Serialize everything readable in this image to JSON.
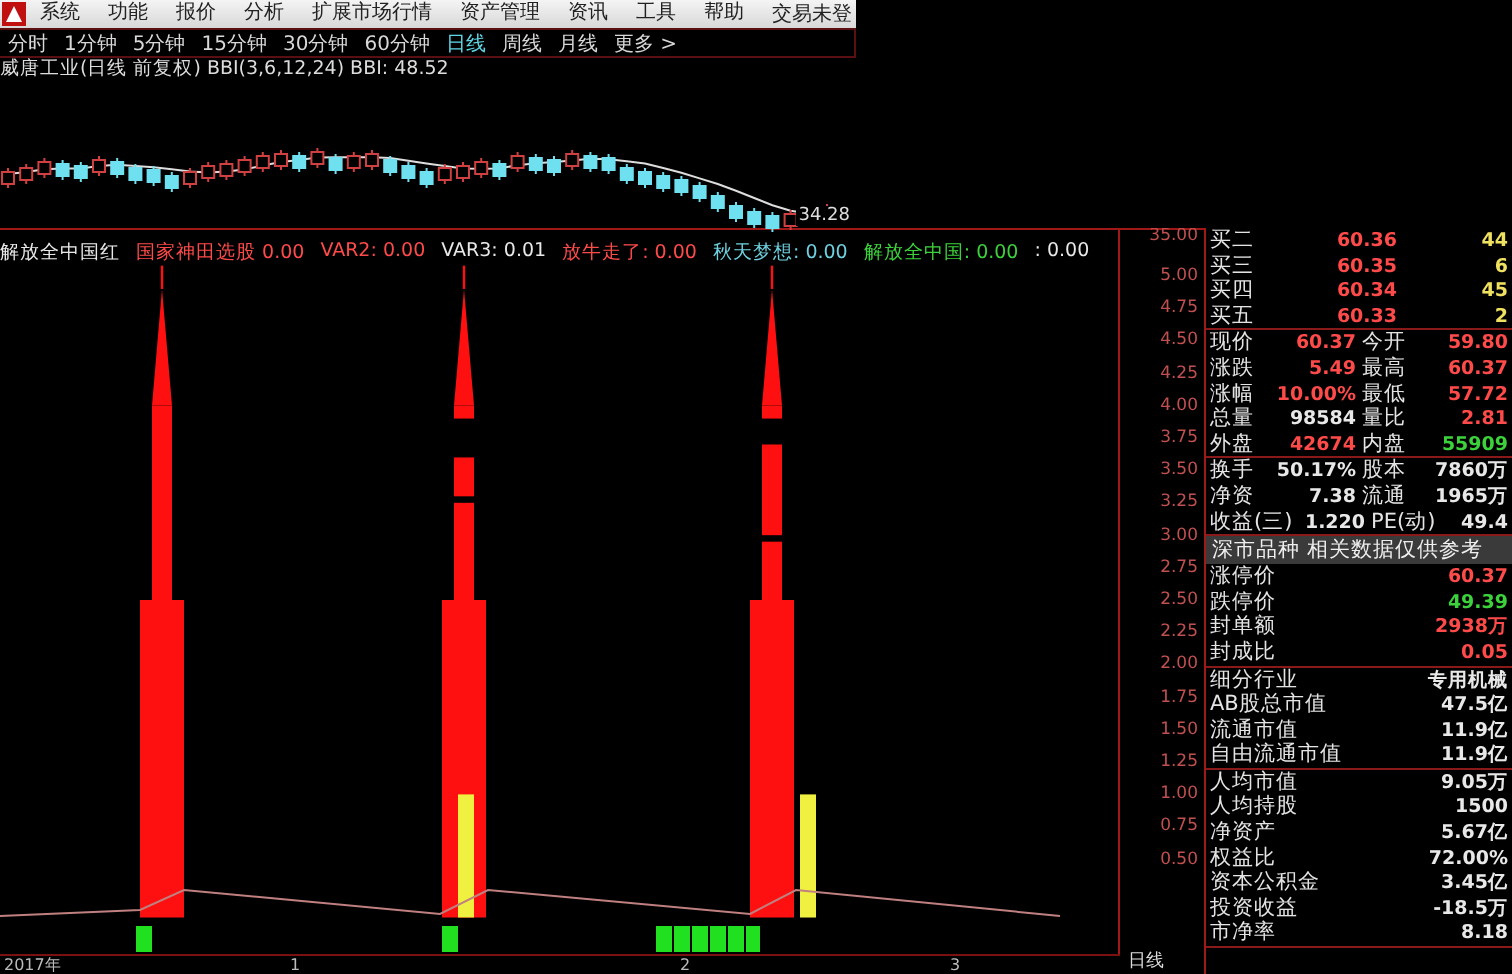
{
  "menu": [
    "系统",
    "功能",
    "报价",
    "分析",
    "扩展市场行情",
    "资产管理",
    "资讯",
    "工具",
    "帮助"
  ],
  "trade_status": "交易未登",
  "periods": [
    {
      "label": "分时",
      "selected": false
    },
    {
      "label": "1分钟",
      "selected": false
    },
    {
      "label": "5分钟",
      "selected": false
    },
    {
      "label": "15分钟",
      "selected": false
    },
    {
      "label": "30分钟",
      "selected": false
    },
    {
      "label": "60分钟",
      "selected": false
    },
    {
      "label": "日线",
      "selected": true
    },
    {
      "label": "周线",
      "selected": false
    },
    {
      "label": "月线",
      "selected": false
    },
    {
      "label": "更多 >",
      "selected": false
    }
  ],
  "price_chart": {
    "title": "威唐工业(日线 前复权) BBI(3,6,12,24) BBI: 48.52",
    "low_label": "34.28"
  },
  "indicator": {
    "name": "解放全中国红",
    "legend": [
      {
        "label": "国家神田选股",
        "value": "0.00",
        "color": "#ff4a4a"
      },
      {
        "label": "VAR2:",
        "value": "0.00",
        "color": "#ff4a4a"
      },
      {
        "label": "VAR3:",
        "value": "0.01",
        "color": "#e8e8e8"
      },
      {
        "label": "放牛走了:",
        "value": "0.00",
        "color": "#ff4a4a"
      },
      {
        "label": "秋天梦想:",
        "value": "0.00",
        "color": "#6fd0e0"
      },
      {
        "label": "解放全中国:",
        "value": "0.00",
        "color": "#3cd23c"
      },
      {
        "label": ":",
        "value": "0.00",
        "color": "#e8e8e8"
      }
    ],
    "y_labels": [
      "35.00",
      "5.00",
      "4.75",
      "4.50",
      "4.25",
      "4.00",
      "3.75",
      "3.50",
      "3.25",
      "3.00",
      "2.75",
      "2.50",
      "2.25",
      "2.00",
      "1.75",
      "1.50",
      "1.25",
      "1.00",
      "0.75",
      "0.50"
    ],
    "x_labels": [
      "2017年",
      "1",
      "2",
      "3"
    ],
    "period_label": "日线"
  },
  "quote": {
    "bids": [
      {
        "label": "买二",
        "price": "60.36",
        "volume": "44"
      },
      {
        "label": "买三",
        "price": "60.35",
        "volume": "6"
      },
      {
        "label": "买四",
        "price": "60.34",
        "volume": "45"
      },
      {
        "label": "买五",
        "price": "60.33",
        "volume": "2"
      }
    ],
    "sections": [
      {
        "kind": "pairs",
        "rows": [
          {
            "items": [
              {
                "label": "现价",
                "value": "60.37",
                "color": "#ff4a4a"
              },
              {
                "label": "今开",
                "value": "59.80",
                "color": "#ff4a4a"
              }
            ]
          },
          {
            "items": [
              {
                "label": "涨跌",
                "value": "5.49",
                "color": "#ff4a4a"
              },
              {
                "label": "最高",
                "value": "60.37",
                "color": "#ff4a4a"
              }
            ]
          },
          {
            "items": [
              {
                "label": "涨幅",
                "value": "10.00%",
                "color": "#ff4a4a"
              },
              {
                "label": "最低",
                "value": "57.72",
                "color": "#ff4a4a"
              }
            ]
          },
          {
            "items": [
              {
                "label": "总量",
                "value": "98584",
                "color": "#e8e8e8"
              },
              {
                "label": "量比",
                "value": "2.81",
                "color": "#ff4a4a"
              }
            ]
          },
          {
            "items": [
              {
                "label": "外盘",
                "value": "42674",
                "color": "#ff4a4a"
              },
              {
                "label": "内盘",
                "value": "55909",
                "color": "#3cd23c"
              }
            ]
          }
        ]
      },
      {
        "kind": "pairs",
        "rows": [
          {
            "items": [
              {
                "label": "换手",
                "value": "50.17%",
                "color": "#e8e8e8"
              },
              {
                "label": "股本",
                "value": "7860万",
                "color": "#e8e8e8"
              }
            ]
          },
          {
            "items": [
              {
                "label": "净资",
                "value": "7.38",
                "color": "#e8e8e8"
              },
              {
                "label": "流通",
                "value": "1965万",
                "color": "#e8e8e8"
              }
            ]
          },
          {
            "items": [
              {
                "label": "收益(三)",
                "value": "1.220",
                "color": "#e8e8e8"
              },
              {
                "label": "PE(动)",
                "value": "49.4",
                "color": "#e8e8e8"
              }
            ]
          }
        ]
      },
      {
        "kind": "banner",
        "text": "深市品种  相关数据仅供参考"
      },
      {
        "kind": "singles",
        "rows": [
          {
            "label": "涨停价",
            "value": "60.37",
            "color": "#ff4a4a"
          },
          {
            "label": "跌停价",
            "value": "49.39",
            "color": "#3cd23c"
          },
          {
            "label": "封单额",
            "value": "2938万",
            "color": "#ff4a4a"
          },
          {
            "label": "封成比",
            "value": "0.05",
            "color": "#ff4a4a"
          }
        ]
      },
      {
        "kind": "singles",
        "rows": [
          {
            "label": "细分行业",
            "value": "专用机械",
            "color": "#e8e8e8"
          },
          {
            "label": "AB股总市值",
            "value": "47.5亿",
            "color": "#e8e8e8"
          },
          {
            "label": "流通市值",
            "value": "11.9亿",
            "color": "#e8e8e8"
          },
          {
            "label": "自由流通市值",
            "value": "11.9亿",
            "color": "#e8e8e8"
          }
        ]
      },
      {
        "kind": "singles",
        "rows": [
          {
            "label": "人均市值",
            "value": "9.05万",
            "color": "#e8e8e8"
          },
          {
            "label": "人均持股",
            "value": "1500",
            "color": "#e8e8e8"
          },
          {
            "label": "净资产",
            "value": "5.67亿",
            "color": "#e8e8e8"
          },
          {
            "label": "权益比",
            "value": "72.00%",
            "color": "#e8e8e8"
          },
          {
            "label": "资本公积金",
            "value": "3.45亿",
            "color": "#e8e8e8"
          },
          {
            "label": "投资收益",
            "value": "-18.5万",
            "color": "#e8e8e8"
          },
          {
            "label": "市净率",
            "value": "8.18",
            "color": "#e8e8e8"
          }
        ]
      }
    ]
  }
}
